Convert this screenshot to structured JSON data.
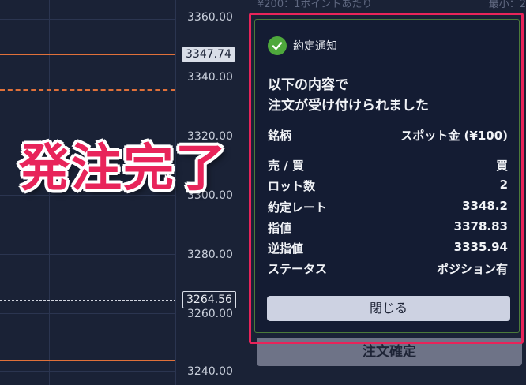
{
  "chart": {
    "price_ticks": [
      "3360.00",
      "3340.00",
      "3320.00",
      "3300.00",
      "3280.00",
      "3260.00",
      "3240.00"
    ],
    "current_price_tag": "3347.74",
    "order_price_tag": "3264.56"
  },
  "right_panel": {
    "top_left_text": "¥200：1ポイントあたり",
    "top_right_text": "最小：2",
    "confirm_button": "注文確定"
  },
  "dialog": {
    "title": "約定通知",
    "message_line1": "以下の内容で",
    "message_line2": "注文が受け付けられました",
    "symbol_label": "銘柄",
    "symbol_value": "スポット金 (¥100)",
    "side_label": "売 / 買",
    "side_value": "買",
    "lot_label": "ロット数",
    "lot_value": "2",
    "rate_label": "約定レート",
    "rate_value": "3348.2",
    "limit_label": "指値",
    "limit_value": "3378.83",
    "stop_label": "逆指値",
    "stop_value": "3335.94",
    "status_label": "ステータス",
    "status_value": "ポジション有",
    "close_button": "閉じる"
  },
  "overlay_title": "発注完了",
  "colors": {
    "accent_pink": "#e8245a",
    "order_line": "#e0713a",
    "success_green": "#4ea83c"
  }
}
